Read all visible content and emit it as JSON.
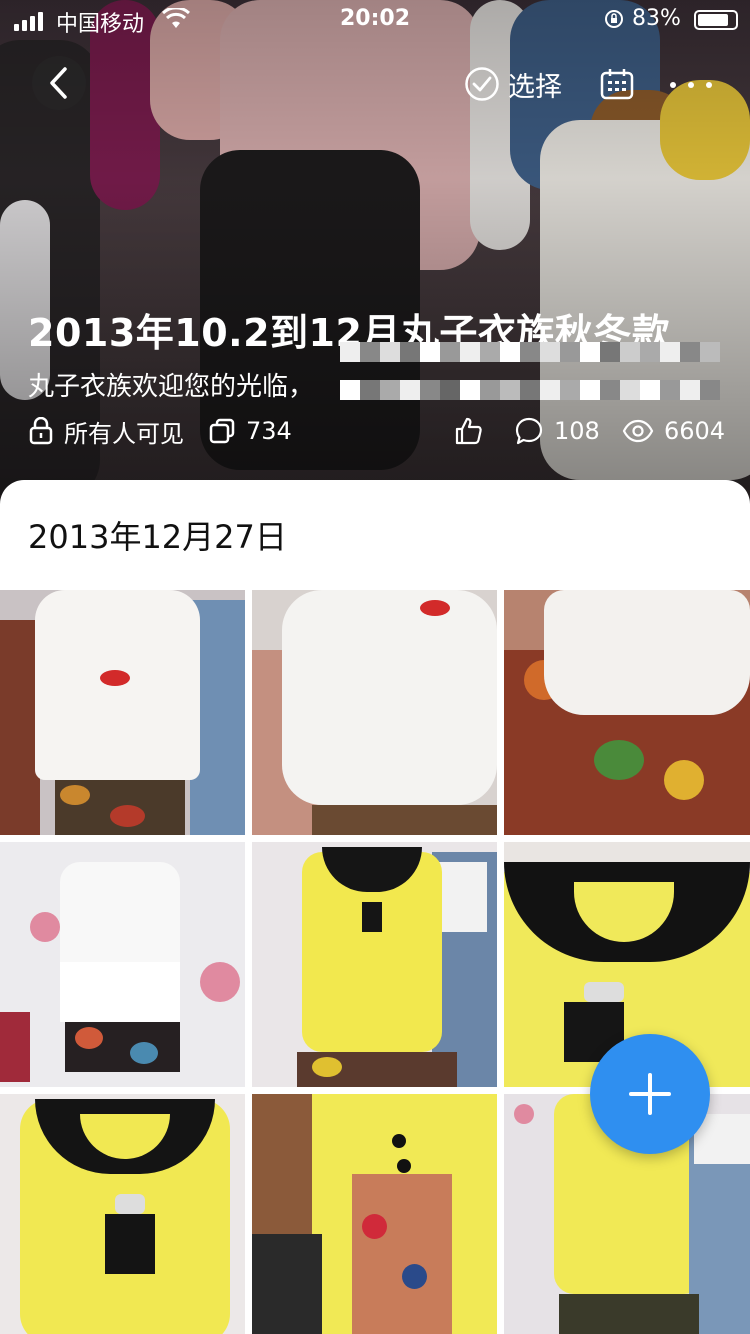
{
  "status_bar": {
    "carrier": "中国移动",
    "time": "20:02",
    "battery_percent": "83%",
    "battery_level": 0.83
  },
  "toolbar": {
    "select_label": "选择",
    "icons": [
      "chevron-left-icon",
      "check-circle-icon",
      "calendar-icon",
      "more-icon"
    ]
  },
  "album": {
    "title": "2013年10.2到12月丸子衣族秋冬款",
    "description": "丸子衣族欢迎您的光临，",
    "visibility": "所有人可见",
    "photo_count": "734",
    "comment_count": "108",
    "view_count": "6604"
  },
  "section": {
    "date": "2013年12月27日"
  },
  "photos": [
    {
      "desc": "white lace top with floral skirt"
    },
    {
      "desc": "white lace sleeve closeup"
    },
    {
      "desc": "lace peplum with floral skirt"
    },
    {
      "desc": "white lace dress on wall"
    },
    {
      "desc": "yellow top with black collar"
    },
    {
      "desc": "yellow top collar closeup"
    },
    {
      "desc": "yellow top with black collar"
    },
    {
      "desc": "yellow coat with buttons"
    },
    {
      "desc": "yellow sleeveless top"
    }
  ],
  "colors": {
    "accent": "#2f8ff0",
    "text_dark": "#111111"
  }
}
